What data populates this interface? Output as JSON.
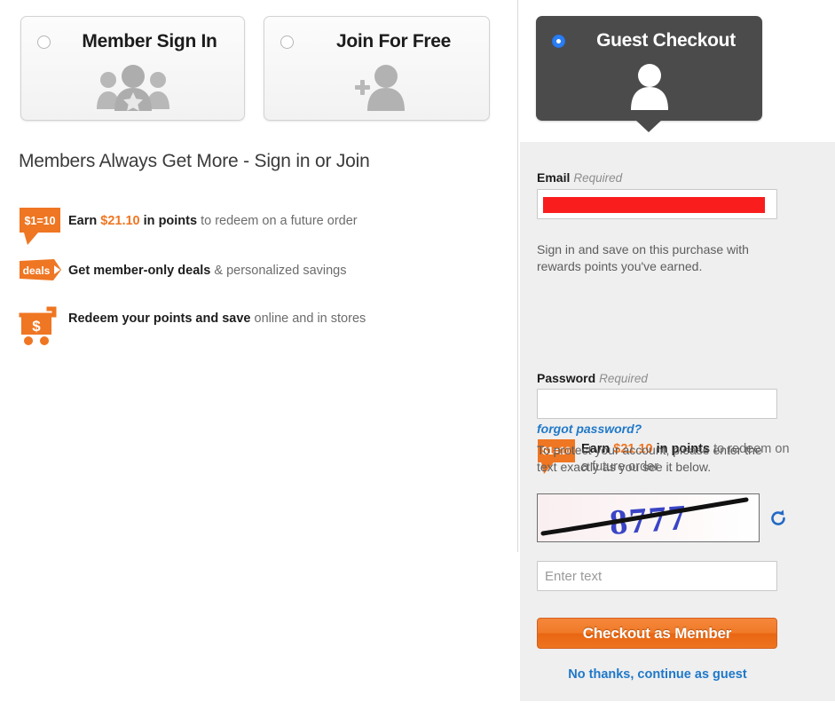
{
  "tabs": [
    {
      "label": "Member Sign In",
      "icon": "members-group-icon",
      "selected": false
    },
    {
      "label": "Join For Free",
      "icon": "add-person-icon",
      "selected": false
    },
    {
      "label": "Guest Checkout",
      "icon": "guest-person-icon",
      "selected": true
    }
  ],
  "left": {
    "heading": "Members Always Get More - Sign in or Join",
    "benefits": [
      {
        "icon": "points-ratio-tag-icon",
        "icon_label": "$1 = 10",
        "pre": "Earn ",
        "amount": "$21.10",
        "bold_tail": " in points",
        "rest": " to redeem on a future order"
      },
      {
        "icon": "deals-tag-icon",
        "icon_label": "deals",
        "pre": "",
        "amount": "",
        "bold_tail": "Get member-only deals",
        "rest": " & personalized savings"
      },
      {
        "icon": "shopping-cart-dollar-icon",
        "icon_label": "$",
        "pre": "",
        "amount": "",
        "bold_tail": "Redeem your points and save",
        "rest": " online and in stores"
      }
    ]
  },
  "panel": {
    "email_label": "Email",
    "email_required": "Required",
    "email_value": "",
    "email_redacted": true,
    "signin_note": "Sign in and save on this purchase with rewards points you've earned.",
    "panel_benefit": {
      "icon": "points-ratio-tag-icon",
      "icon_label": "$1 = 10",
      "pre": "Earn ",
      "amount": "$21.10",
      "bold_tail": " in points",
      "rest": " to redeem on a future order"
    },
    "password_label": "Password",
    "password_required": "Required",
    "password_value": "",
    "forgot_password": "forgot password?",
    "captcha_note": "To protect your account, please enter the text exactly as you see it below.",
    "captcha_text": "8777",
    "captcha_refresh_icon": "refresh-icon",
    "captcha_input_placeholder": "Enter text",
    "captcha_input_value": "",
    "submit_label": "Checkout as Member",
    "guest_link": "No thanks, continue as guest"
  },
  "colors": {
    "accent_orange": "#ef7622",
    "link_blue": "#1f78c8",
    "radio_blue": "#2b7ef1",
    "panel_gray": "#efeff0",
    "tab_dark": "#4b4b4b",
    "redaction_red": "#f91d1d",
    "captcha_blue": "#3a44c6"
  }
}
